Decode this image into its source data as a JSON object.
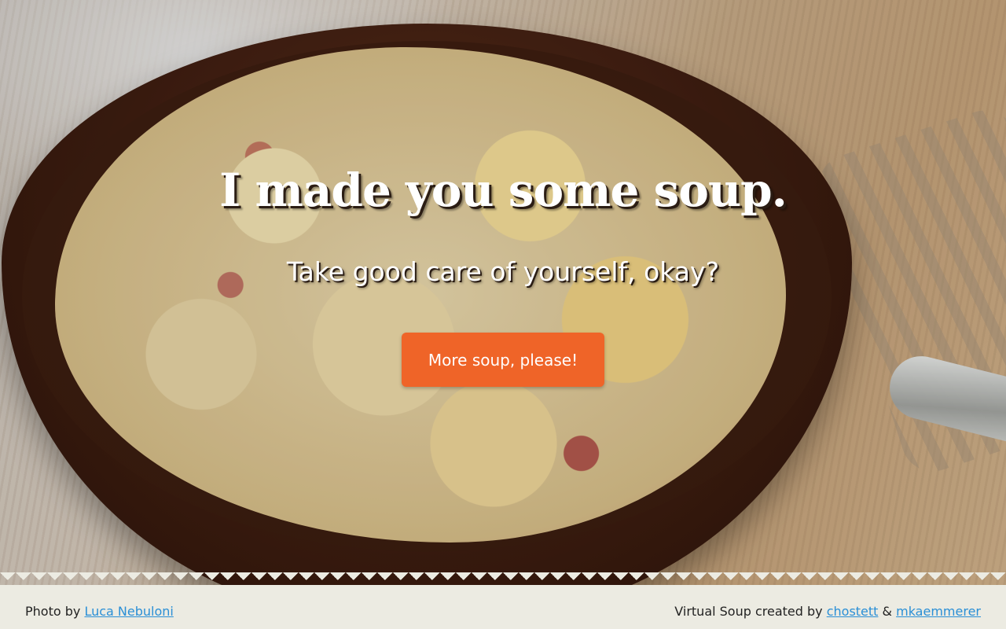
{
  "hero": {
    "headline": "I made you some soup.",
    "tagline": "Take good care of yourself, okay?",
    "button_label": "More soup, please!"
  },
  "footer": {
    "photo_prefix": "Photo by ",
    "photo_author": "Luca Nebuloni",
    "credits_prefix": "Virtual Soup created by ",
    "creator_one": "chostett",
    "separator": " & ",
    "creator_two": "mkaemmerer"
  },
  "colors": {
    "accent": "#ef6428",
    "link": "#2a8fd6",
    "footer_bg": "#ecebe2"
  }
}
